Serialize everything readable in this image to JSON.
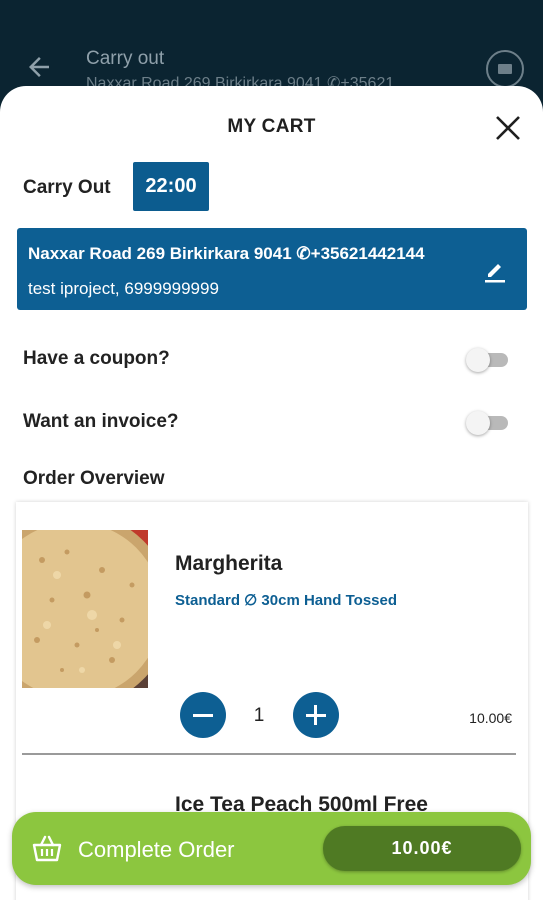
{
  "background": {
    "title": "Carry out",
    "subtitle": "Naxxar Road 269 Birkirkara 9041 ✆+35621",
    "back_icon": "back-arrow-icon",
    "card_icon": "card-icon"
  },
  "cart": {
    "title": "MY CART",
    "close_icon": "close-icon",
    "carry_label": "Carry Out",
    "time": "22:00",
    "address": {
      "line1": "Naxxar Road 269 Birkirkara 9041 ✆+35621442144",
      "line2": "test iproject, 6999999999",
      "edit_icon": "edit-icon"
    },
    "coupon_label": "Have a coupon?",
    "coupon_enabled": false,
    "invoice_label": "Want an invoice?",
    "invoice_enabled": false,
    "overview_title": "Order Overview",
    "items": [
      {
        "name": "Margherita",
        "description": "Standard ∅ 30cm Hand Tossed",
        "quantity": "1",
        "price": "10.00€"
      },
      {
        "name": "Ice Tea Peach 500ml Free"
      }
    ]
  },
  "checkout": {
    "label": "Complete Order",
    "total": "10.00€",
    "icon": "basket-icon"
  },
  "colors": {
    "primary": "#0d5f93",
    "accent_green": "#8cc63f",
    "dark_green": "#4f7a23",
    "app_bar": "#0b2431"
  }
}
